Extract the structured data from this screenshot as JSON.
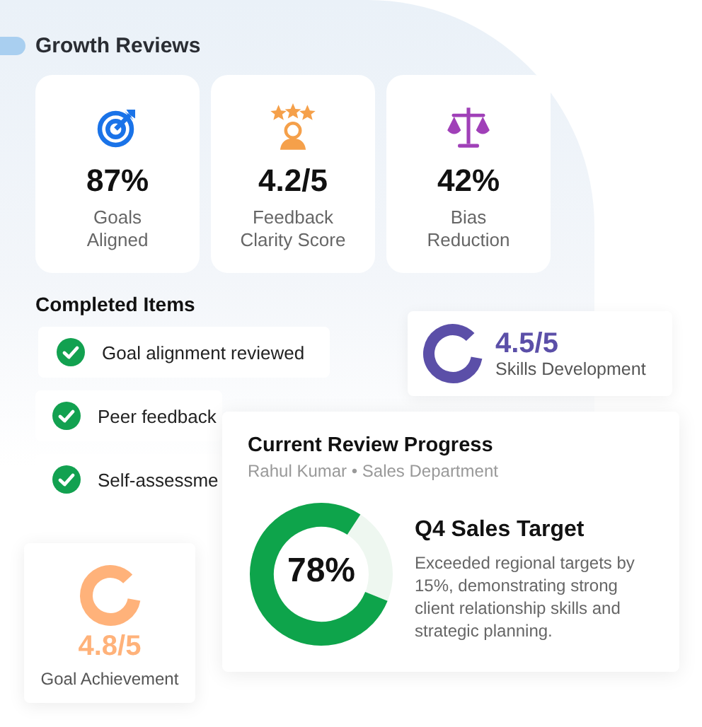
{
  "title": "Growth Reviews",
  "stats": [
    {
      "kind": "target",
      "value": "87%",
      "label": "Goals Aligned"
    },
    {
      "kind": "stars",
      "value": "4.2/5",
      "label": "Feedback Clarity Score"
    },
    {
      "kind": "scale",
      "value": "42%",
      "label": "Bias Reduction"
    }
  ],
  "completed": {
    "title": "Completed Items",
    "items": [
      {
        "text": "Goal alignment reviewed",
        "checked": true
      },
      {
        "text": "Peer feedback",
        "checked": true
      },
      {
        "text": "Self-assessme",
        "checked": true
      }
    ]
  },
  "skills": {
    "value": "4.5/5",
    "label": "Skills Development"
  },
  "progress": {
    "title": "Current Review Progress",
    "subtitle": "Rahul Kumar • Sales Department",
    "reading": "78%",
    "heading": "Q4 Sales Target",
    "text": "Exceeded regional targets by 15%, demonstrating strong client relationship skills and strategic planning."
  },
  "goal": {
    "value": "4.8/5",
    "label": "Goal Achievement"
  }
}
